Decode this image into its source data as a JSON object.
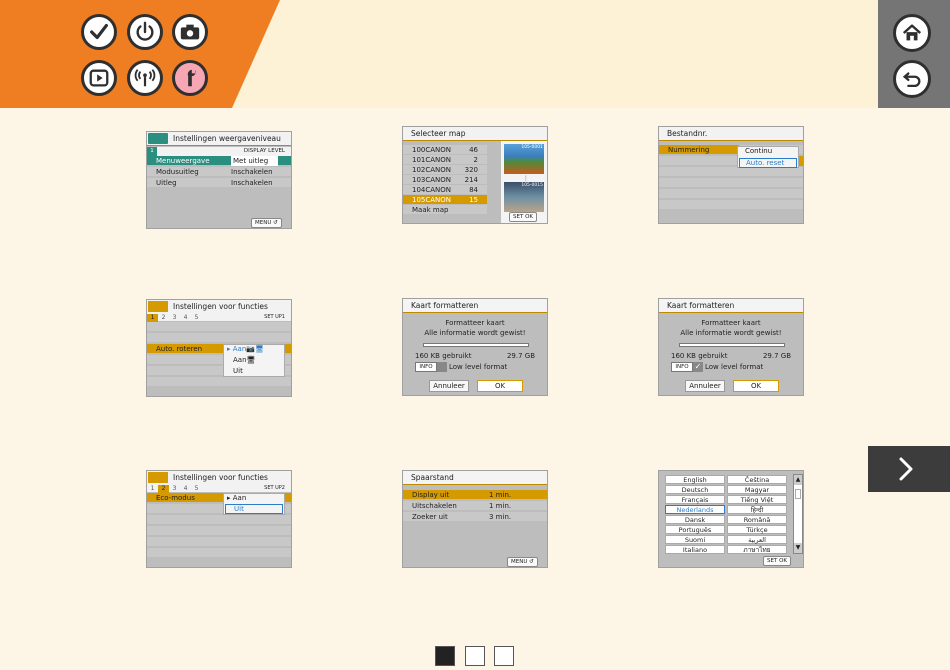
{
  "colors": {
    "accent": "#ef7d22",
    "highlight": "#d49a00",
    "background": "#fdf5e6"
  },
  "header": {
    "mode_icons": [
      "checkmark-icon",
      "power-icon",
      "camera-icon",
      "play-icon",
      "wireless-icon",
      "wrench-icon"
    ],
    "nav_icons": [
      "home-icon",
      "back-icon"
    ]
  },
  "s1": {
    "title": "Instellingen weergaveniveau",
    "tab": "1",
    "sub": "DISPLAY LEVEL",
    "rows": [
      {
        "label": "Menuweergave",
        "value": "Met uitleg"
      },
      {
        "label": "Modusuitleg",
        "value": "Inschakelen"
      },
      {
        "label": "Uitleg",
        "value": "Inschakelen"
      }
    ],
    "menu_btn": "MENU ↺"
  },
  "s2": {
    "title": "Selecteer map",
    "folders": [
      {
        "name": "100CANON",
        "count": "46"
      },
      {
        "name": "101CANON",
        "count": "2"
      },
      {
        "name": "102CANON",
        "count": "320"
      },
      {
        "name": "103CANON",
        "count": "214"
      },
      {
        "name": "104CANON",
        "count": "84"
      },
      {
        "name": "105CANON",
        "count": "15"
      }
    ],
    "make": "Maak map",
    "thumb_top": "105-0001",
    "thumb_bottom": "105-0015",
    "btn": "SET OK"
  },
  "s3": {
    "title": "Bestandnr.",
    "label": "Nummering",
    "opt1": "Continu",
    "opt2": "Auto. reset"
  },
  "s4": {
    "title": "Instellingen voor functies",
    "tabs": [
      "1",
      "2",
      "3",
      "4",
      "5"
    ],
    "sub": "SET UP1",
    "label": "Auto. roteren",
    "opt1": "Aan",
    "opt2": "Aan",
    "opt3": "Uit"
  },
  "s5": {
    "title": "Kaart formatteren",
    "l1": "Formatteer kaart",
    "l2": "Alle informatie wordt gewist!",
    "used": "160 KB gebruikt",
    "total": "29.7 GB",
    "info": "INFO",
    "low": "Low level format",
    "cancel": "Annuleer",
    "ok": "OK"
  },
  "s6": {
    "title": "Kaart formatteren",
    "l1": "Formatteer kaart",
    "l2": "Alle informatie wordt gewist!",
    "used": "160 KB gebruikt",
    "total": "29.7 GB",
    "info": "INFO",
    "check": "✓",
    "low": "Low level format",
    "cancel": "Annuleer",
    "ok": "OK"
  },
  "s7": {
    "title": "Instellingen voor functies",
    "tabs": [
      "1",
      "2",
      "3",
      "4",
      "5"
    ],
    "sub": "SET UP2",
    "label": "Eco-modus",
    "opt1": "Aan",
    "opt2": "Uit"
  },
  "s8": {
    "title": "Spaarstand",
    "rows": [
      {
        "label": "Display uit",
        "value": "1 min."
      },
      {
        "label": "Uitschakelen",
        "value": "1 min."
      },
      {
        "label": "Zoeker uit",
        "value": "3 min."
      }
    ],
    "menu_btn": "MENU ↺"
  },
  "s9": {
    "languages": [
      [
        "English",
        "Čeština"
      ],
      [
        "Deutsch",
        "Magyar"
      ],
      [
        "Français",
        "Tiếng Việt"
      ],
      [
        "Nederlands",
        "हिन्दी"
      ],
      [
        "Dansk",
        "Română"
      ],
      [
        "Português",
        "Türkçe"
      ],
      [
        "Suomi",
        "العربية"
      ],
      [
        "Italiano",
        "ภาษาไทย"
      ]
    ],
    "btn": "SET OK"
  },
  "pagination": {
    "pages": 3,
    "current": 1
  }
}
